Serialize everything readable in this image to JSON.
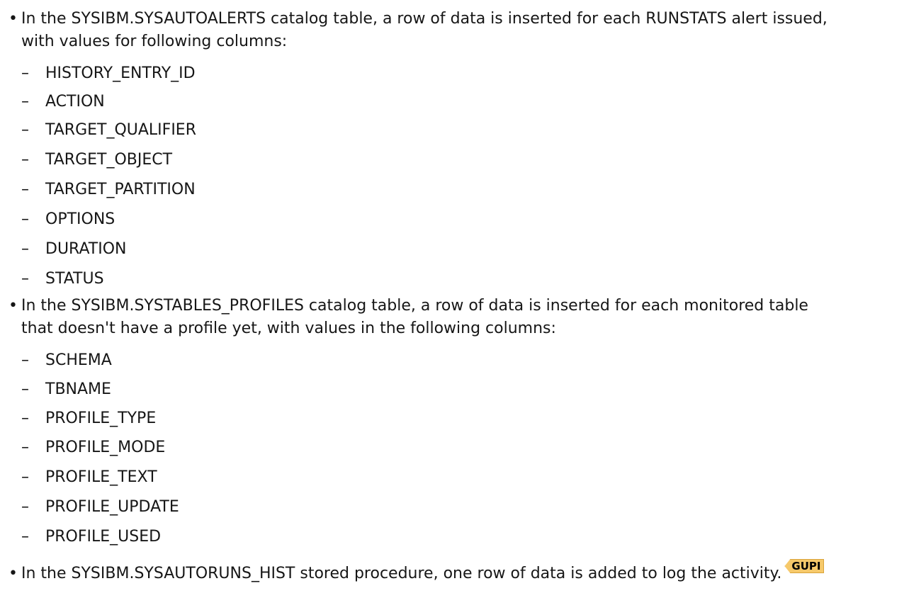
{
  "bullets": [
    {
      "marker": "•",
      "line1": "In the SYSIBM.SYSAUTOALERTS catalog table, a row of data is inserted for each RUNSTATS alert issued,",
      "line2": "with values for following columns:",
      "items": [
        "HISTORY_ENTRY_ID",
        "ACTION",
        "TARGET_QUALIFIER",
        "TARGET_OBJECT",
        "TARGET_PARTITION",
        "OPTIONS",
        "DURATION",
        "STATUS"
      ]
    },
    {
      "marker": "•",
      "line1": "In the SYSIBM.SYSTABLES_PROFILES catalog table, a row of data is inserted for each monitored table",
      "line2": "that doesn't have a profile yet, with values in the following columns:",
      "items": [
        "SCHEMA",
        "TBNAME",
        "PROFILE_TYPE",
        "PROFILE_MODE",
        "PROFILE_TEXT",
        "PROFILE_UPDATE",
        "PROFILE_USED"
      ]
    },
    {
      "marker": "•",
      "line1": "In the SYSIBM.SYSAUTORUNS_HIST stored procedure, one row of data is added to log the activity.",
      "tag": "GUPI"
    }
  ],
  "dash": "–"
}
